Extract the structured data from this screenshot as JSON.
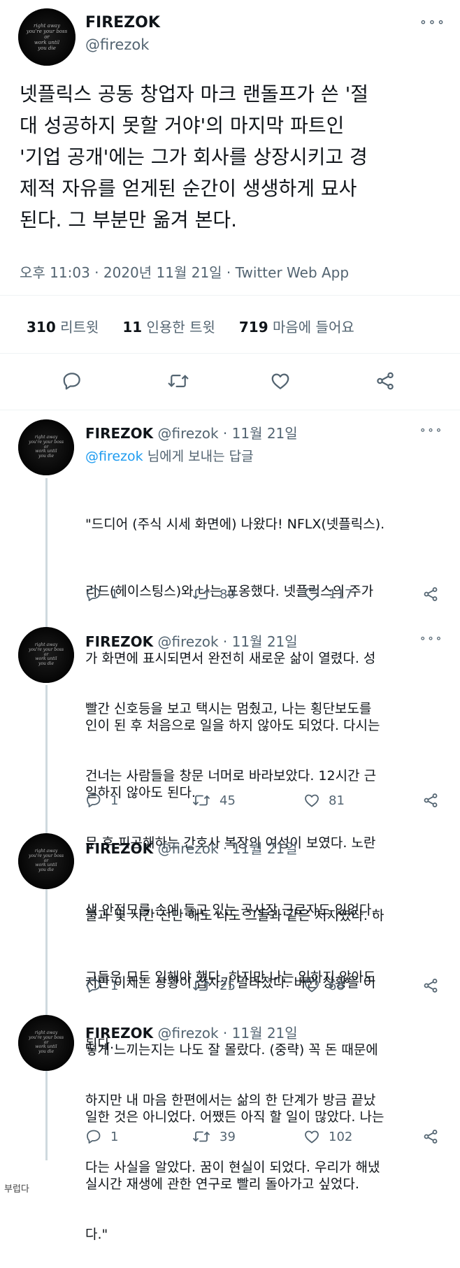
{
  "main_tweet": {
    "display_name": "FIREZOK",
    "handle": "@firezok",
    "avatar_text": "right away\nyou're your boss\nor\nwork until\nyou die",
    "lines": [
      "넷플릭스 공동 창업자 마크 랜돌프가 쓴 '절",
      "대 성공하지 못할 거야'의 마지막 파트인",
      "'기업 공개'에는 그가 회사를 상장시키고 경",
      "제적 자유를 얻게된 순간이 생생하게 묘사",
      "된다. 그 부분만 옮겨 본다."
    ],
    "meta": "오후 11:03 · 2020년 11월 21일 · Twitter Web App",
    "stats": {
      "retweets_count": "310",
      "retweets_label": "리트윗",
      "quotes_count": "11",
      "quotes_label": "인용한 트윗",
      "likes_count": "719",
      "likes_label": "마음에 들어요"
    },
    "more_label": "∘∘∘"
  },
  "replies": [
    {
      "display_name": "FIREZOK",
      "handle": "@firezok",
      "date": "· 11월 21일",
      "reply_to_handle": "@firezok",
      "reply_to_suffix": " 님에게 보내는 답글",
      "lines": [
        "\"드디어 (주식 시세 화면에) 나왔다! NFLX(넷플릭스).",
        "리드(헤이스팅스)와 나는 포옹했다. 넷플릭스의 주가",
        "가 화면에 표시되면서 완전히 새로운 삶이 열렸다. 성",
        "인이 된 후 처음으로 일을 하지 않아도 되었다. 다시는",
        "일하지 않아도 된다."
      ],
      "replies": "1",
      "retweets": "80",
      "likes": "117"
    },
    {
      "display_name": "FIREZOK",
      "handle": "@firezok",
      "date": "· 11월 21일",
      "lines": [
        "빨간 신호등을 보고 택시는 멈췄고, 나는 횡단보도를",
        "건너는 사람들을 창문 너머로 바라보았다. 12시간 근",
        "무 후 피곤해하는 간호사 복장의 여성이 보였다. 노란",
        "색 안전모를 손에 들고 있는 공사장 근로자도 있었다.",
        "그들은 모두 일해야 했다. 하지만 나는 일하지 않아도",
        "된다."
      ],
      "replies": "1",
      "retweets": "45",
      "likes": "81"
    },
    {
      "display_name": "FIREZOK",
      "handle": "@firezok",
      "date": "· 11월 21일",
      "lines": [
        "불과 몇 시간 전만 해도 나도 그들과 같은 처지였다. 하",
        "지만 이제는 상황이 갑자기 달라졌다. 바뀐 상황을 어",
        "떻게 느끼는지는 나도 잘 몰랐다. (중략) 꼭 돈 때문에",
        "일한 것은 아니었다. 어쨌든 아직 할 일이 많았다. 나는",
        "실시간 재생에 관한 연구로 빨리 돌아가고 싶었다."
      ],
      "replies": "1",
      "retweets": "25",
      "likes": "68"
    },
    {
      "display_name": "FIREZOK",
      "handle": "@firezok",
      "date": "· 11월 21일",
      "lines": [
        "하지만 내 마음 한편에서는 삶의 한 단계가 방금 끝났",
        "다는 사실을 알았다. 꿈이 현실이 되었다. 우리가 해냈",
        "다.\""
      ],
      "replies": "1",
      "retweets": "39",
      "likes": "102"
    }
  ],
  "watermark": "부럽다",
  "icons": {
    "reply": "reply-icon",
    "retweet": "retweet-icon",
    "like": "like-icon",
    "share": "share-icon",
    "more": "more-icon"
  }
}
